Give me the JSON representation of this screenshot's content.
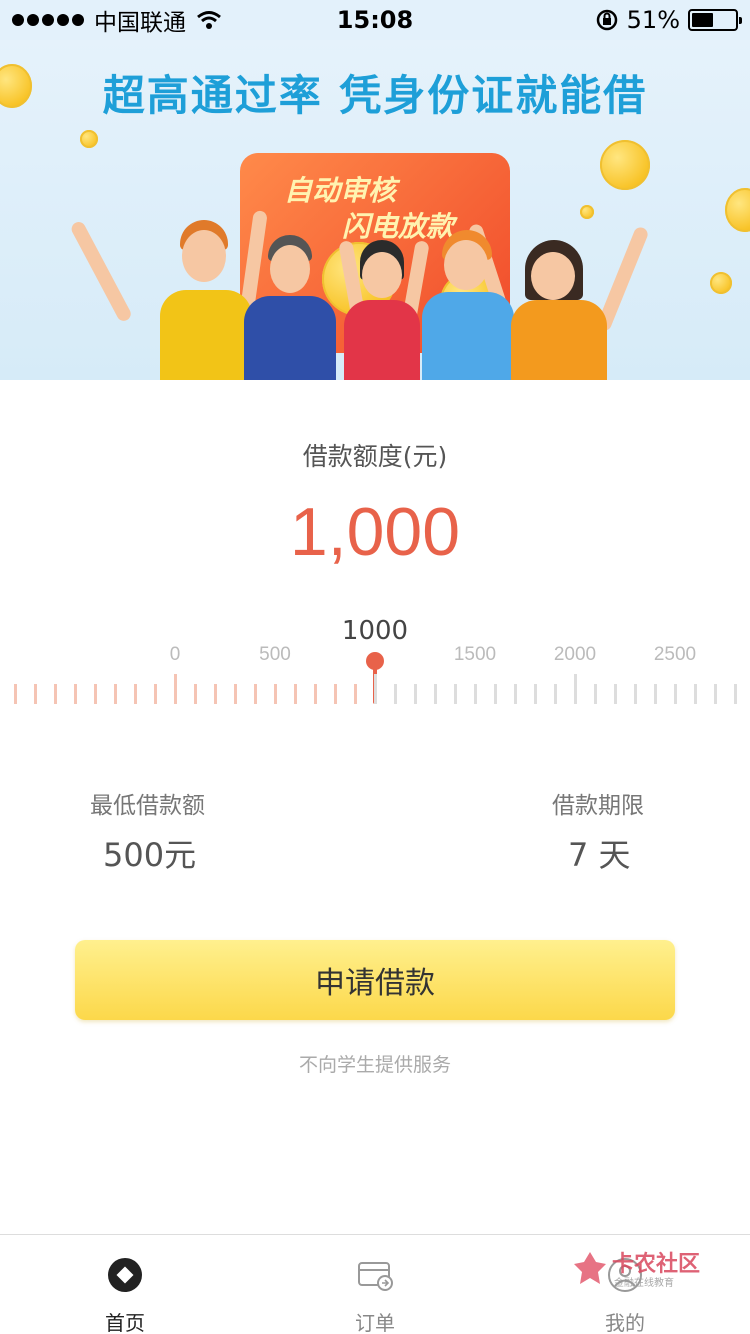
{
  "status_bar": {
    "carrier": "中国联通",
    "time": "15:08",
    "battery_percent": "51%",
    "battery_level": 0.51,
    "icons": [
      "signal-dots-icon",
      "wifi-icon",
      "orientation-lock-icon",
      "battery-icon"
    ]
  },
  "banner": {
    "title": "超高通过率 凭身份证就能借",
    "card_line_1": "自动审核",
    "card_line_2": "闪电放款",
    "colors": {
      "title": "#1e9fd8",
      "card": "#f04a2a",
      "background": "#e5f2fb"
    }
  },
  "loan": {
    "amount_label": "借款额度(元)",
    "amount_value": "1,000",
    "accent_color": "#e8624a",
    "slider": {
      "current_label": "1000",
      "current_value": 1000,
      "tick_labels": [
        "0",
        "500",
        "1500",
        "2000",
        "2500"
      ]
    },
    "min_amount_label": "最低借款额",
    "min_amount_value": "500元",
    "term_label": "借款期限",
    "term_value": "7 天",
    "apply_button": "申请借款",
    "disclaimer": "不向学生提供服务"
  },
  "tab_bar": {
    "items": [
      {
        "label": "首页",
        "icon": "home-icon",
        "active": true
      },
      {
        "label": "订单",
        "icon": "order-icon",
        "active": false
      },
      {
        "label": "我的",
        "icon": "profile-icon",
        "active": false
      }
    ]
  },
  "watermark": {
    "title": "卡农社区",
    "subtitle": "金融在线教育"
  }
}
